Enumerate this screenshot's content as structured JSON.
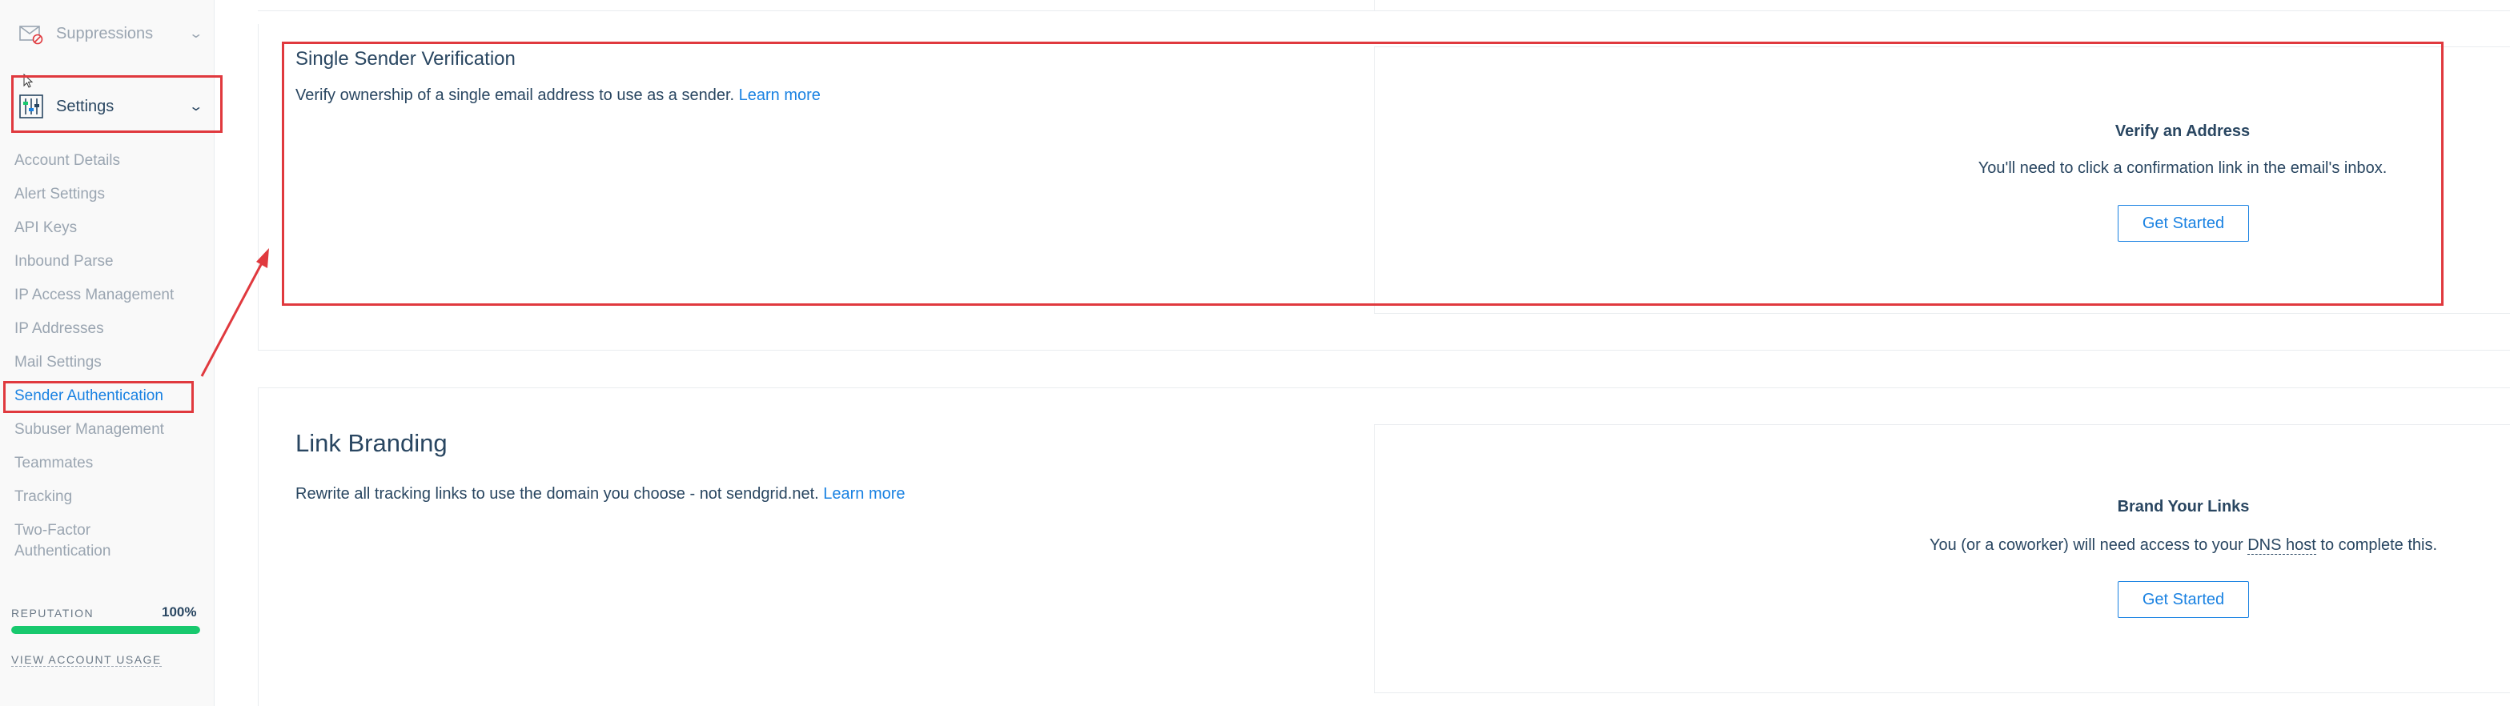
{
  "sidebar": {
    "suppressions_label": "Suppressions",
    "settings_label": "Settings",
    "items": [
      {
        "label": "Account Details"
      },
      {
        "label": "Alert Settings"
      },
      {
        "label": "API Keys"
      },
      {
        "label": "Inbound Parse"
      },
      {
        "label": "IP Access Management"
      },
      {
        "label": "IP Addresses"
      },
      {
        "label": "Mail Settings"
      },
      {
        "label": "Sender Authentication"
      },
      {
        "label": "Subuser Management"
      },
      {
        "label": "Teammates"
      },
      {
        "label": "Tracking"
      },
      {
        "label": "Two-Factor Authentication"
      }
    ],
    "reputation": {
      "label": "REPUTATION",
      "value_text": "100%",
      "value": 1.0
    },
    "usage_link": "VIEW ACCOUNT USAGE"
  },
  "single_sender": {
    "title": "Single Sender Verification",
    "description": "Verify ownership of a single email address to use as a sender.",
    "learn_more": "Learn more",
    "panel_title": "Verify an Address",
    "panel_desc": "You'll need to click a confirmation link in the email's inbox.",
    "button": "Get Started"
  },
  "link_branding": {
    "title": "Link Branding",
    "description": "Rewrite all tracking links to use the domain you choose - not sendgrid.net.",
    "learn_more": "Learn more",
    "panel_title": "Brand Your Links",
    "panel_desc_before": "You (or a coworker) will need access to your",
    "panel_desc_term": "DNS host",
    "panel_desc_after": "to complete this.",
    "button": "Get Started"
  },
  "colors": {
    "accent": "#1a82e2",
    "text": "#294661",
    "muted": "#9aa5b1",
    "annotation": "#e0393e",
    "reputation_bar": "#18c96e"
  }
}
